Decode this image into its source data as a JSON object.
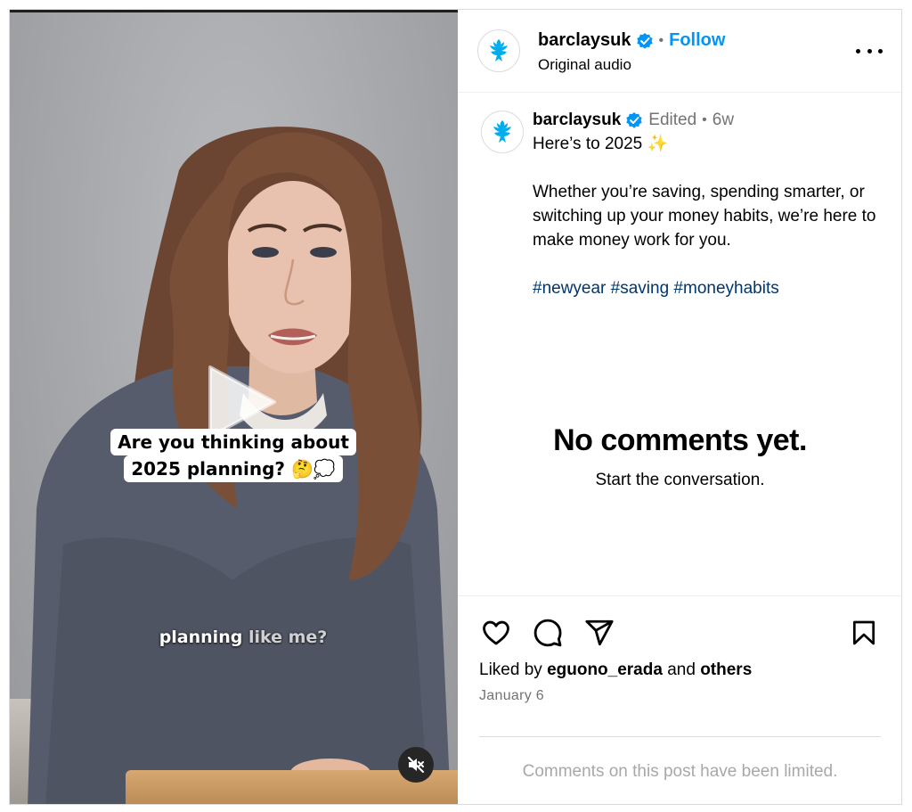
{
  "video": {
    "overlay_caption_line1": "Are you thinking about",
    "overlay_caption_line2": "2025 planning? 🤔💭",
    "subtitle_word1": "planning",
    "subtitle_word2": "like me?",
    "mute_icon": "speaker-muted-icon",
    "play_icon": "play-icon"
  },
  "header": {
    "username": "barclaysuk",
    "separator": "•",
    "follow_label": "Follow",
    "audio_label": "Original audio",
    "more_icon": "more-options-icon"
  },
  "post": {
    "username": "barclaysuk",
    "edited_label": "Edited",
    "separator": "•",
    "age": "6w",
    "caption_line1": "Here’s to 2025 ✨",
    "caption_paragraph": "Whether you’re saving, spending smarter, or switching up your money habits, we’re here to make money work for you.",
    "hashtags": "#newyear #saving #moneyhabits"
  },
  "comments": {
    "empty_title": "No comments yet.",
    "empty_subtitle": "Start the conversation.",
    "limited_notice": "Comments on this post have been limited."
  },
  "actions": {
    "liked_prefix": "Liked by",
    "liked_user": "eguono_erada",
    "liked_and": "and",
    "liked_others": "others",
    "date": "January 6",
    "icons": [
      "heart-icon",
      "comment-icon",
      "share-icon",
      "bookmark-icon"
    ]
  },
  "colors": {
    "follow_blue": "#0095f6",
    "hashtag_blue": "#00376b",
    "verified_blue": "#0095f6",
    "barclays_logo_blue": "#00aeef",
    "muted_text": "#737373"
  }
}
